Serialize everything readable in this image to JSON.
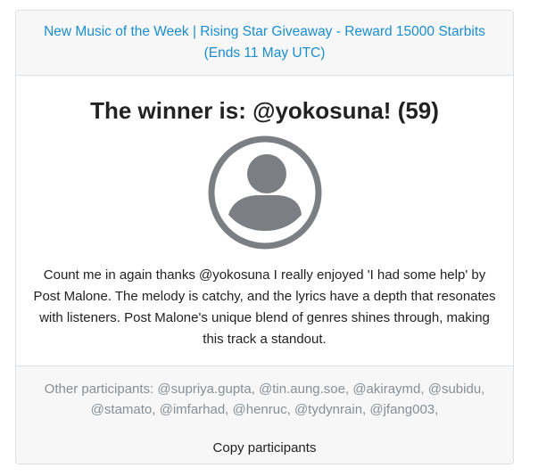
{
  "header": {
    "giveaway_link": "New Music of the Week | Rising Star Giveaway - Reward 15000 Starbits (Ends 11 May UTC)"
  },
  "winner": {
    "title": "The winner is: @yokosuna! (59)",
    "avatar_icon": "user-avatar-icon",
    "comment": "Count me in again thanks @yokosuna I really enjoyed 'I had some help' by Post Malone. The melody is catchy, and the lyrics have a depth that resonates with listeners. Post Malone's unique blend of genres shines through, making this track a standout."
  },
  "footer": {
    "participants_label": "Other participants:",
    "participants_list": "@supriya.gupta, @tin.aung.soe, @akiraymd, @subidu, @stamato, @imfarhad, @henruc, @tydynrain, @jfang003,",
    "copy_button_label": "Copy participants"
  },
  "colors": {
    "link": "#1a8ed1",
    "avatar": "#7b7f83",
    "muted_text": "#868e96"
  }
}
